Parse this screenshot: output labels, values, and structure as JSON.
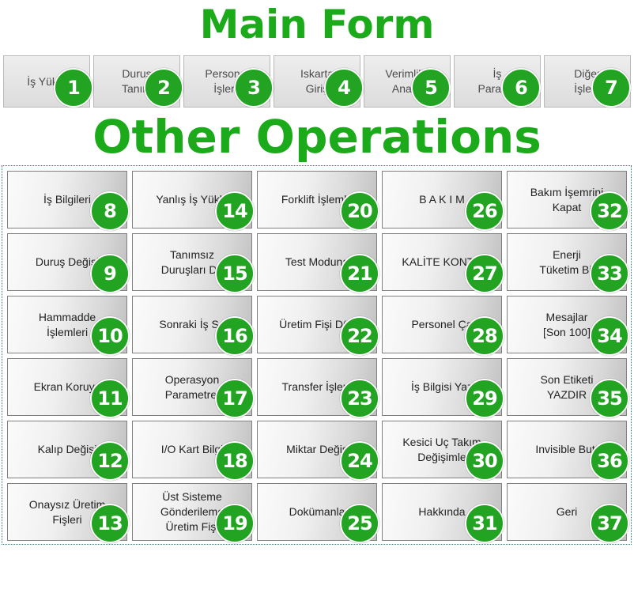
{
  "headings": {
    "main_form": "Main Form",
    "other_operations": "Other Operations"
  },
  "main_buttons": [
    {
      "label": "İş Yükle",
      "badge": "1"
    },
    {
      "label": "Duruş\nTanım",
      "badge": "2"
    },
    {
      "label": "Personel\nİşlem",
      "badge": "3"
    },
    {
      "label": "Iskarta\nGiriş",
      "badge": "4"
    },
    {
      "label": "Verimlilik\nAnaliz",
      "badge": "5"
    },
    {
      "label": "İş\nParame",
      "badge": "6"
    },
    {
      "label": "Diğer\nİşlem",
      "badge": "7"
    }
  ],
  "other_buttons": [
    {
      "label": "İş Bilgileri",
      "badge": "8"
    },
    {
      "label": "Duruş Değişi",
      "badge": "9"
    },
    {
      "label": "Hammadde\nİşlemleri",
      "badge": "10"
    },
    {
      "label": "Ekran Koruyu",
      "badge": "11"
    },
    {
      "label": "Kalıp Değişi",
      "badge": "12"
    },
    {
      "label": "Onaysız Üretim\nFişleri",
      "badge": "13"
    },
    {
      "label": "Yanlış İş Yükle",
      "badge": "14"
    },
    {
      "label": "Tanımsız\nDuruşları De",
      "badge": "15"
    },
    {
      "label": "Sonraki İş Se",
      "badge": "16"
    },
    {
      "label": "Operasyon\nParametrel",
      "badge": "17"
    },
    {
      "label": "I/O Kart Bilgi",
      "badge": "18"
    },
    {
      "label": "Üst Sisteme\nGönderileme\nÜretim Fişl",
      "badge": "19"
    },
    {
      "label": "Forklift İşlemle",
      "badge": "20"
    },
    {
      "label": "Test Moduna",
      "badge": "21"
    },
    {
      "label": "Üretim Fişi Düz",
      "badge": "22"
    },
    {
      "label": "Transfer İşlem",
      "badge": "23"
    },
    {
      "label": "Miktar Değiş",
      "badge": "24"
    },
    {
      "label": "Dokümanla",
      "badge": "25"
    },
    {
      "label": "B A K I M",
      "badge": "26"
    },
    {
      "label": "KALİTE KONTR",
      "badge": "27"
    },
    {
      "label": "Personel Ça",
      "badge": "28"
    },
    {
      "label": "İş Bilgisi Yaz",
      "badge": "29"
    },
    {
      "label": "Kesici Uç Takım\nDeğişimle",
      "badge": "30"
    },
    {
      "label": "Hakkında",
      "badge": "31"
    },
    {
      "label": "Bakım İşemrini\nKapat",
      "badge": "32"
    },
    {
      "label": "Enerji\nTüketim Bil",
      "badge": "33"
    },
    {
      "label": "Mesajlar\n[Son 100]",
      "badge": "34"
    },
    {
      "label": "Son Etiketi\nYAZDIR",
      "badge": "35"
    },
    {
      "label": "Invisible Butt",
      "badge": "36"
    },
    {
      "label": "Geri",
      "badge": "37"
    }
  ],
  "colors": {
    "heading_green": "#1aaa1a",
    "badge_green": "#22a322"
  }
}
